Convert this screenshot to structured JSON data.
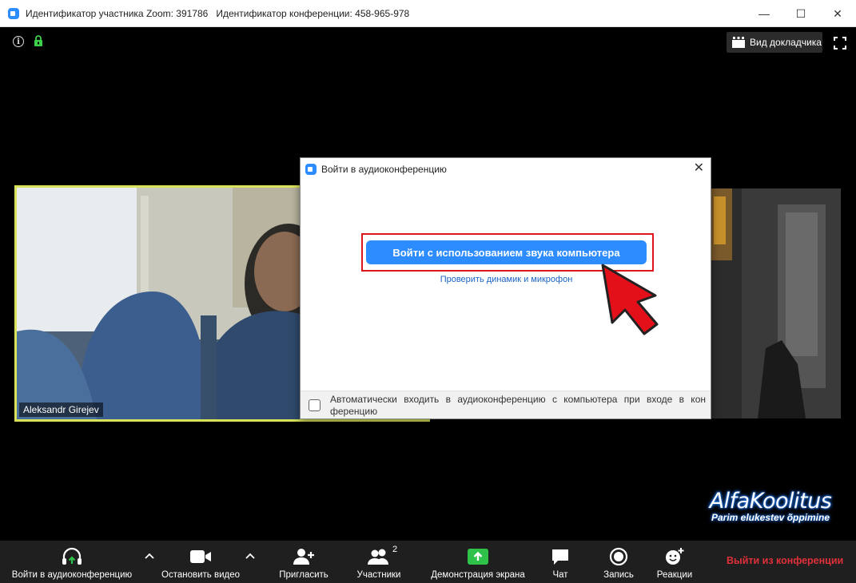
{
  "titlebar": {
    "participant_id": "Идентификатор участника Zoom: 391786",
    "meeting_id": "Идентификатор конференции: 458-965-978",
    "minimize": "—",
    "maximize": "☐",
    "close": "✕"
  },
  "top": {
    "info": "i",
    "speaker_view": "Вид докладчика"
  },
  "video": {
    "participant_name": "Aleksandr Girejev"
  },
  "dialog": {
    "title": "Войти в аудиоконференцию",
    "close": "✕",
    "join_button": "Войти с использованием звука компьютера",
    "test_link": "Проверить динамик и микрофон",
    "auto_join_text": "Автоматически входить в аудиоконференцию с компьютера при входе в кон ференцию"
  },
  "watermark": {
    "title_a": "Alfa",
    "title_b": "Koolitus",
    "subtitle": "Parim elukestev õppimine"
  },
  "toolbar": {
    "join_audio": "Войти в аудиоконференцию",
    "stop_video": "Остановить видео",
    "invite": "Пригласить",
    "participants": "Участники",
    "participants_count": "2",
    "share_screen": "Демонстрация экрана",
    "chat": "Чат",
    "record": "Запись",
    "reactions": "Реакции",
    "leave": "Выйти из конференции"
  },
  "colors": {
    "accent": "#2D8CFF",
    "share_green": "#2fc24b",
    "leave_red": "#e0303a",
    "highlight_red": "#e0141c",
    "video_border": "#d8e25a"
  }
}
